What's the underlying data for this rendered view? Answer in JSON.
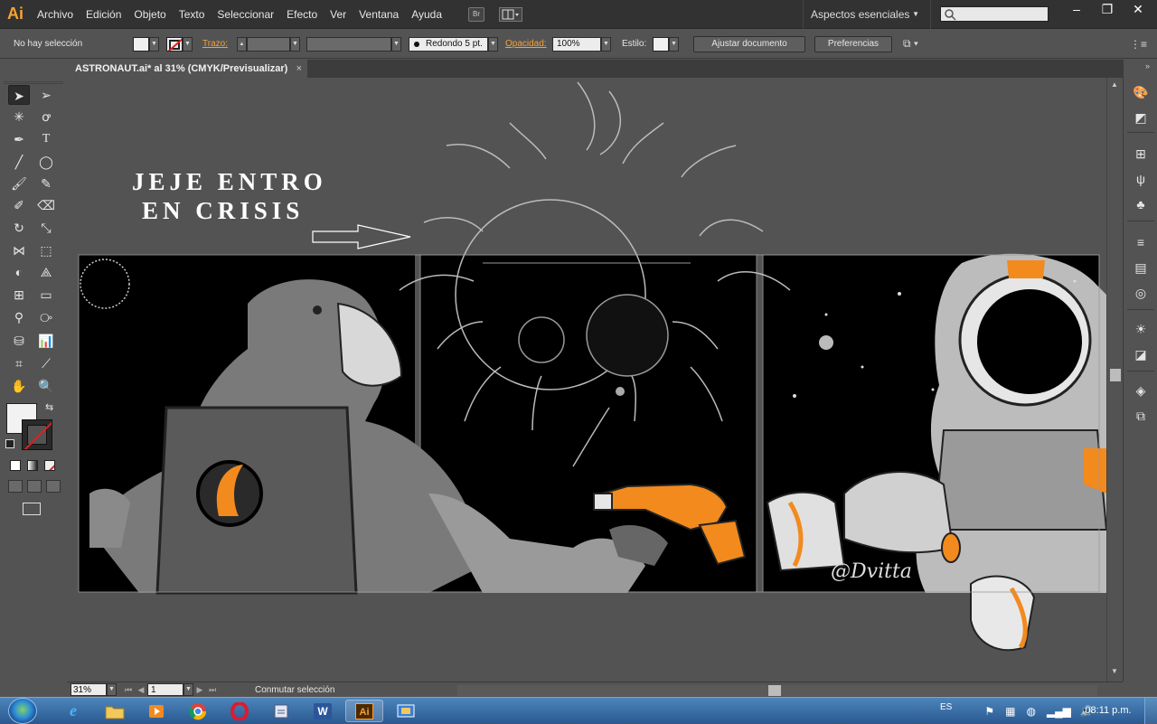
{
  "app": {
    "logo": "Ai",
    "menu": [
      "Archivo",
      "Edición",
      "Objeto",
      "Texto",
      "Seleccionar",
      "Efecto",
      "Ver",
      "Ventana",
      "Ayuda"
    ],
    "bridge_label": "Br",
    "workspace": "Aspectos esenciales",
    "window_buttons": [
      "‒",
      "❐",
      "✕"
    ]
  },
  "control_bar": {
    "selection": "No hay selección",
    "stroke_label": "Trazo:",
    "brush": "Redondo 5 pt.",
    "opacity_label": "Opacidad:",
    "opacity_value": "100%",
    "style_label": "Estilo:",
    "fit_document": "Ajustar documento",
    "preferences": "Preferencias"
  },
  "document": {
    "tab_title": "ASTRONAUT.ai* al 31% (CMYK/Previsualizar)",
    "tab_close": "×"
  },
  "artwork": {
    "title_line1": "JEJE ENTRO",
    "title_line2": "EN CRISIS",
    "signature": "@Dvitta"
  },
  "status": {
    "zoom": "31%",
    "page": "1",
    "message": "Conmutar selección"
  },
  "taskbar": {
    "language": "ES",
    "clock": "08:11 p.m.",
    "word_label": "W",
    "illustrator_label": "Ai"
  },
  "colors": {
    "accent_orange": "#f7a234",
    "art_orange": "#f28a1e",
    "menu_bg": "#323232",
    "panel_bg": "#535353"
  }
}
